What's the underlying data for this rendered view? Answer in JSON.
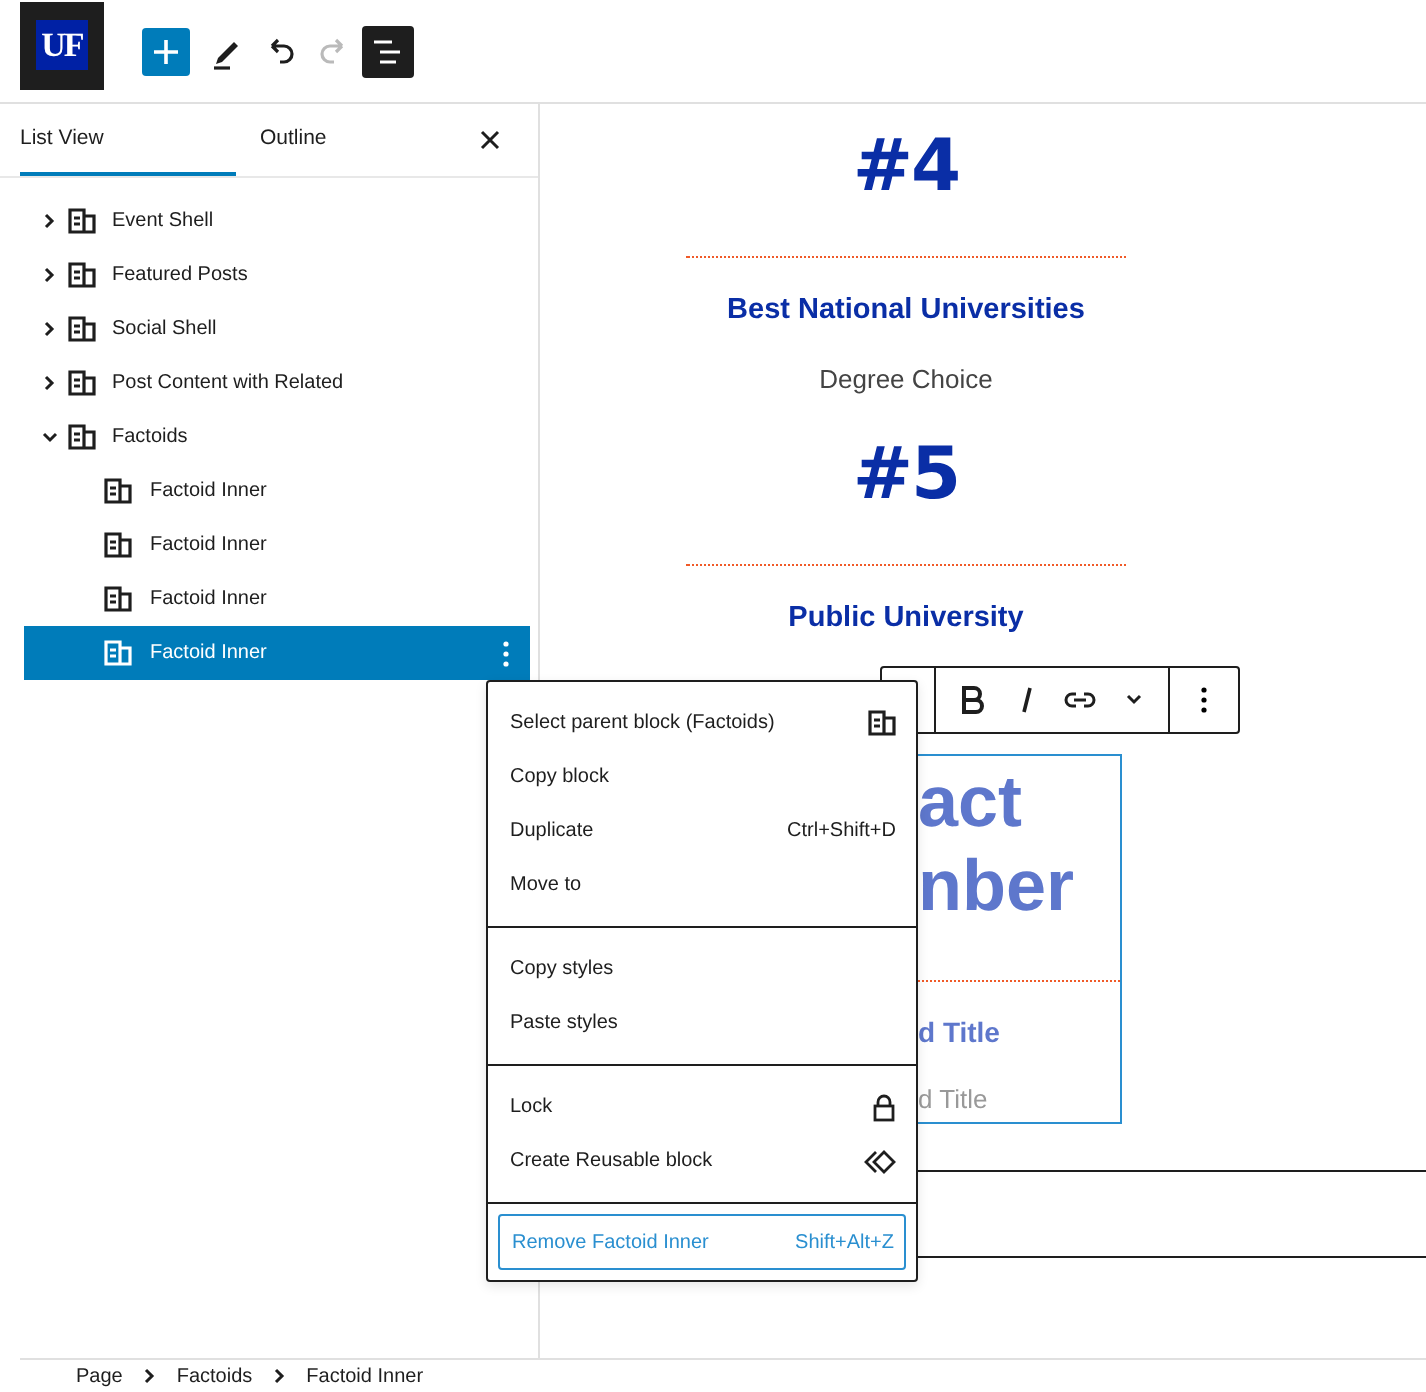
{
  "toolbar": {
    "logo": "UF",
    "items": [
      {
        "kind": "add",
        "pressed": false,
        "disabled": false
      },
      {
        "kind": "edit",
        "pressed": false,
        "disabled": false
      },
      {
        "kind": "undo",
        "pressed": false,
        "disabled": false
      },
      {
        "kind": "redo",
        "pressed": false,
        "disabled": true
      },
      {
        "kind": "list",
        "pressed": true,
        "disabled": false
      }
    ]
  },
  "sidebar": {
    "tabs": [
      {
        "label": "List View",
        "selected": true
      },
      {
        "label": "Outline",
        "selected": false
      }
    ],
    "tree": [
      {
        "label": "Event Shell",
        "expanded": false,
        "selected": false
      },
      {
        "label": "Featured Posts",
        "expanded": false,
        "selected": false
      },
      {
        "label": "Social Shell",
        "expanded": false,
        "selected": false
      },
      {
        "label": "Post Content with Related",
        "expanded": false,
        "selected": false
      },
      {
        "label": "Factoids",
        "expanded": true,
        "selected": false,
        "children": [
          {
            "label": "Factoid Inner",
            "selected": false
          },
          {
            "label": "Factoid Inner",
            "selected": false
          },
          {
            "label": "Factoid Inner",
            "selected": false
          },
          {
            "label": "Factoid Inner",
            "selected": true
          }
        ]
      }
    ]
  },
  "editor": {
    "blocks": [
      {
        "kind": "number",
        "text": "#4"
      },
      {
        "kind": "divider"
      },
      {
        "kind": "title",
        "text": "Best National Universities"
      },
      {
        "kind": "subtitle",
        "text": "Degree Choice"
      },
      {
        "kind": "number",
        "text": "#5"
      },
      {
        "kind": "divider"
      },
      {
        "kind": "title",
        "text": "Public University"
      }
    ],
    "selected_block": {
      "lines": [
        "act",
        "nber"
      ],
      "title": "d Title",
      "subtitle": "d Title"
    }
  },
  "context_menu": {
    "groups": [
      [
        {
          "label": "Select parent block (Factoids)",
          "focused": false
        },
        {
          "label": "Copy block",
          "focused": false
        },
        {
          "label": "Duplicate",
          "shortcut": "Ctrl+Shift+D",
          "focused": false
        },
        {
          "label": "Move to",
          "focused": false
        }
      ],
      [
        {
          "label": "Copy styles",
          "focused": false
        },
        {
          "label": "Paste styles",
          "focused": false
        }
      ],
      [
        {
          "label": "Lock",
          "focused": false
        },
        {
          "label": "Create Reusable block",
          "focused": false
        }
      ],
      [
        {
          "label": "Remove Factoid Inner",
          "shortcut": "Shift+Alt+Z",
          "focused": true
        }
      ]
    ]
  },
  "breadcrumb": [
    "Page",
    "Factoids",
    "Factoid Inner"
  ]
}
